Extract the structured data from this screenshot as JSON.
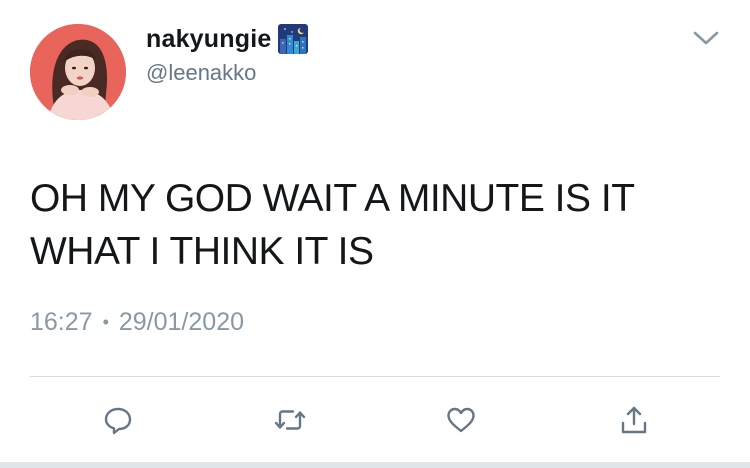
{
  "tweet": {
    "display_name": "nakyungie",
    "name_emoji": "cityscape-at-night-emoji",
    "handle": "@leenakko",
    "text": "OH MY GOD WAIT A MINUTE IS IT\nWHAT I THINK IT IS",
    "time": "16:27",
    "separator": "•",
    "date": "29/01/2020"
  },
  "icons": {
    "menu": "chevron-down-icon",
    "reply": "reply-icon",
    "retweet": "retweet-icon",
    "like": "heart-icon",
    "share": "share-icon"
  },
  "colors": {
    "text": "#14171a",
    "secondary": "#657786",
    "meta": "#8899a6",
    "icon": "#657786",
    "divider": "#d6dde2"
  }
}
